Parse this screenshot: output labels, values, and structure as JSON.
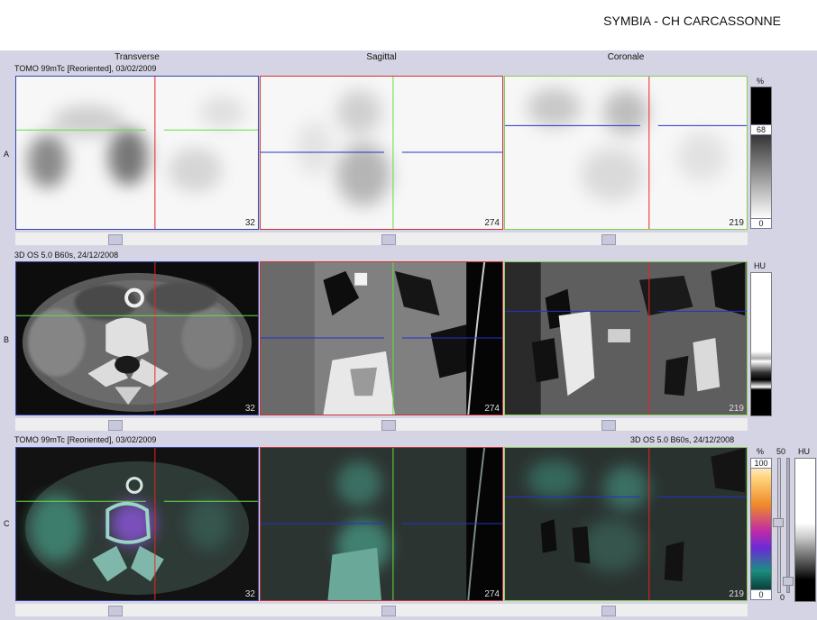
{
  "header": {
    "site_title": "SYMBIA - CH CARCASSONNE"
  },
  "columns": {
    "transverse": "Transverse",
    "sagittal": "Sagittal",
    "coronal": "Coronale"
  },
  "rows": {
    "a": {
      "letter": "A",
      "series": "TOMO 99mTc [Reoriented], 03/02/2009"
    },
    "b": {
      "letter": "B",
      "series": "3D  OS  5.0  B60s, 24/12/2008"
    },
    "c": {
      "letter": "C",
      "series_left": "TOMO 99mTc [Reoriented], 03/02/2009",
      "series_right": "3D  OS  5.0  B60s, 24/12/2008"
    }
  },
  "slices": {
    "transverse": "32",
    "sagittal": "274",
    "coronal": "219"
  },
  "colorbars": {
    "a": {
      "unit": "%",
      "top_value": "68",
      "bottom_value": "0"
    },
    "b": {
      "unit": "HU"
    },
    "c": {
      "unit": "%",
      "top_value": "100",
      "bottom_value": "0",
      "right_unit": "HU",
      "mid_value": "50",
      "slider_bottom": "0"
    }
  },
  "colors": {
    "transverse_border": "#3344aa",
    "sagittal_border": "#cc3333",
    "coronal_border": "#88cc55",
    "crosshair_red": "#ee2222",
    "crosshair_green": "#66dd44",
    "crosshair_blue": "#2233cc"
  }
}
